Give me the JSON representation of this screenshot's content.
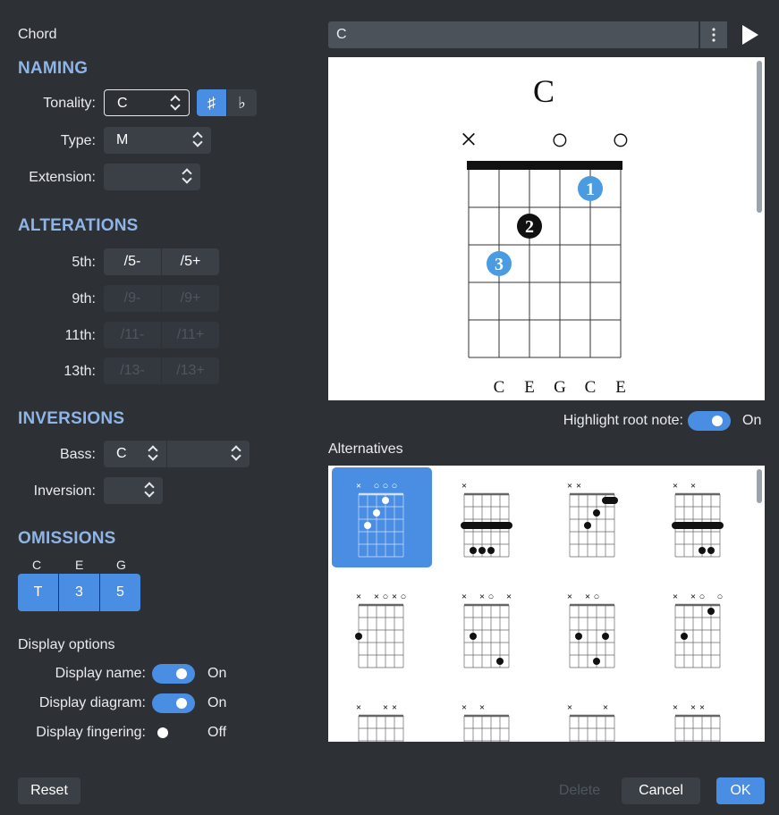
{
  "window_title": "Chord",
  "chord_name_field": {
    "value": "C"
  },
  "naming": {
    "heading": "NAMING",
    "tonality_label": "Tonality:",
    "tonality_value": "C",
    "sharp_label": "♯",
    "flat_label": "♭",
    "type_label": "Type:",
    "type_value": "M",
    "extension_label": "Extension:",
    "extension_value": ""
  },
  "alterations": {
    "heading": "ALTERATIONS",
    "rows": [
      {
        "label": "5th:",
        "a": "/5-",
        "b": "/5+",
        "enabled": true
      },
      {
        "label": "9th:",
        "a": "/9-",
        "b": "/9+",
        "enabled": false
      },
      {
        "label": "11th:",
        "a": "/11-",
        "b": "/11+",
        "enabled": false
      },
      {
        "label": "13th:",
        "a": "/13-",
        "b": "/13+",
        "enabled": false
      }
    ]
  },
  "inversions": {
    "heading": "INVERSIONS",
    "bass_label": "Bass:",
    "bass_value": "C",
    "bass_extra_value": "",
    "inversion_label": "Inversion:",
    "inversion_value": ""
  },
  "omissions": {
    "heading": "OMISSIONS",
    "notes": [
      "C",
      "E",
      "G"
    ],
    "buttons": [
      "T",
      "3",
      "5"
    ]
  },
  "display_options": {
    "heading": "Display options",
    "items": [
      {
        "label": "Display name:",
        "state": "On",
        "on": true
      },
      {
        "label": "Display diagram:",
        "state": "On",
        "on": true
      },
      {
        "label": "Display fingering:",
        "state": "Off",
        "on": false
      }
    ]
  },
  "diagram": {
    "chord_name": "C",
    "string_markers": [
      "×",
      "",
      "",
      "○",
      "",
      "○"
    ],
    "fingers": [
      {
        "string": 5,
        "fret": 1,
        "label": "1",
        "color": "#4a9be0"
      },
      {
        "string": 3,
        "fret": 2,
        "label": "2",
        "color": "#111111"
      },
      {
        "string": 2,
        "fret": 3,
        "label": "3",
        "color": "#4a9be0"
      }
    ],
    "notes": [
      "C",
      "E",
      "G",
      "C",
      "E"
    ]
  },
  "highlight_root": {
    "label": "Highlight root note:",
    "state": "On"
  },
  "alternatives": {
    "heading": "Alternatives"
  },
  "footer": {
    "reset": "Reset",
    "delete": "Delete",
    "cancel": "Cancel",
    "ok": "OK"
  },
  "colors": {
    "accent": "#4a8ee3",
    "background": "#2d3136",
    "section_heading": "#8fb4e6"
  }
}
